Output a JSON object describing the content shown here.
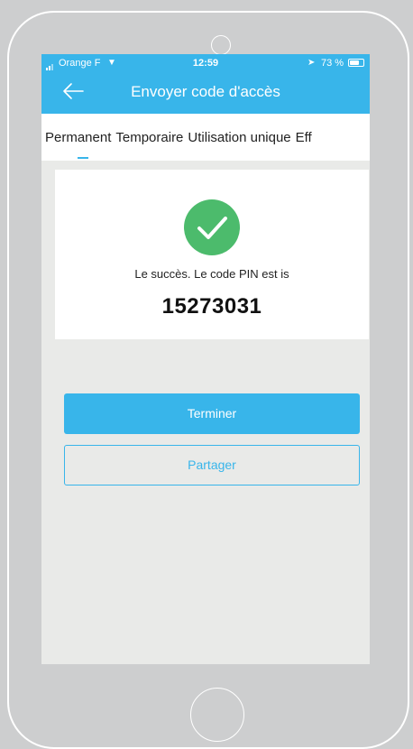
{
  "status_bar": {
    "carrier": "Orange F",
    "time": "12:59",
    "battery": "73 %"
  },
  "header": {
    "title": "Envoyer code d'accès",
    "back_icon": "arrow-left-icon"
  },
  "tabs": [
    "Permanent",
    "Temporaire",
    "Utilisation unique",
    "Eff"
  ],
  "active_tab": "Permanent",
  "result": {
    "message": "Le succès. Le code PIN est is",
    "pin": "15273031",
    "icon": "check-circle-icon"
  },
  "actions": {
    "finish": "Terminer",
    "share": "Partager"
  },
  "colors": {
    "accent": "#38b5ea",
    "success": "#4cbb6c",
    "background": "#e9eae8"
  }
}
